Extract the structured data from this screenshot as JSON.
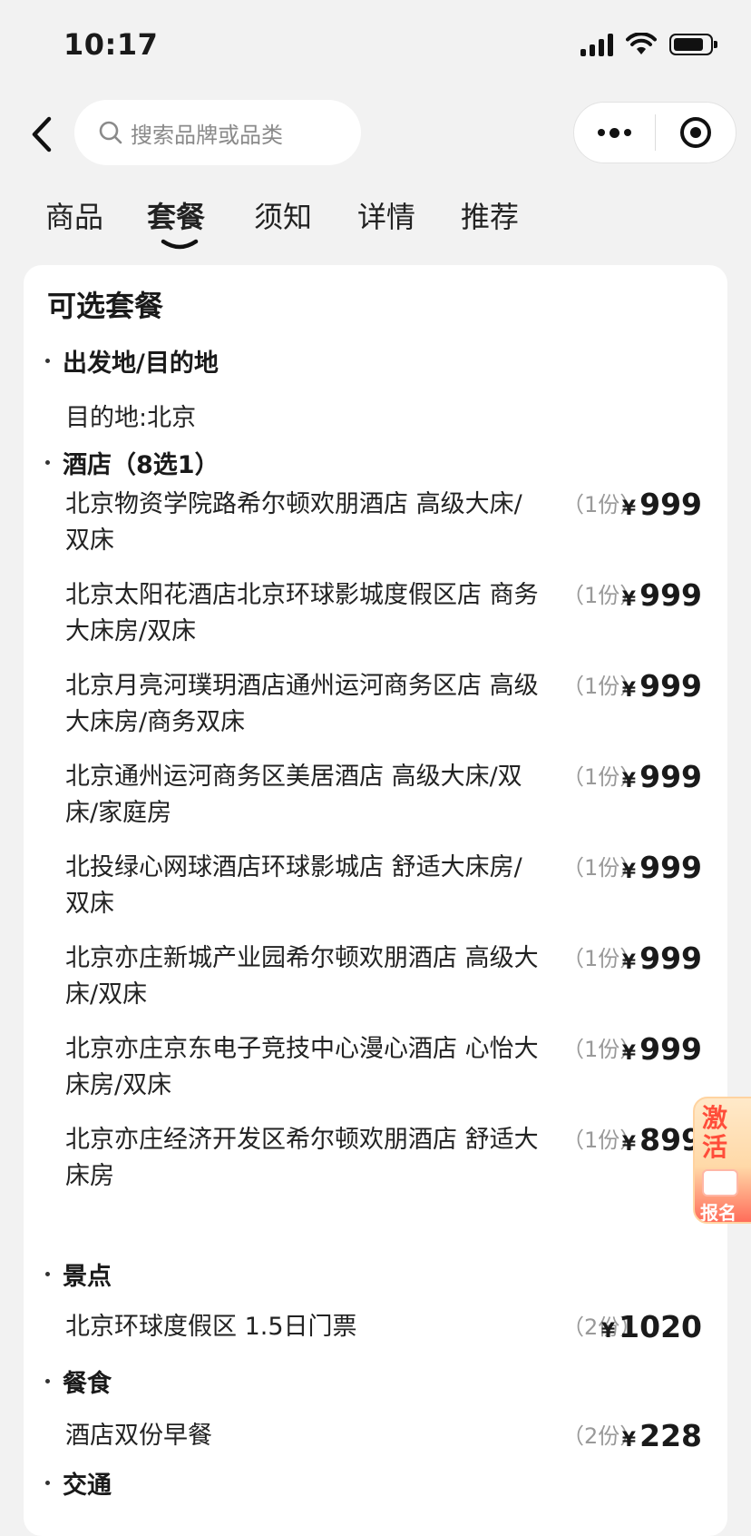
{
  "status_bar": {
    "time": "10:17"
  },
  "search": {
    "placeholder": "搜索品牌或品类"
  },
  "tabs": [
    {
      "label": "商品",
      "active": false
    },
    {
      "label": "套餐",
      "active": true
    },
    {
      "label": "须知",
      "active": false
    },
    {
      "label": "详情",
      "active": false
    },
    {
      "label": "推荐",
      "active": false
    }
  ],
  "card": {
    "title": "可选套餐",
    "origin_section": {
      "title": "出发地/目的地",
      "text": "目的地:北京"
    },
    "hotel_section": {
      "title": "酒店（8选1）",
      "items": [
        {
          "name": "北京物资学院路希尔顿欢朋酒店 高级大床/双床",
          "qty": "（1份）",
          "currency": "¥",
          "price": "999"
        },
        {
          "name": "北京太阳花酒店北京环球影城度假区店 商务大床房/双床",
          "qty": "（1份）",
          "currency": "¥",
          "price": "999"
        },
        {
          "name": "北京月亮河璞玥酒店通州运河商务区店 高级大床房/商务双床",
          "qty": "（1份）",
          "currency": "¥",
          "price": "999"
        },
        {
          "name": "北京通州运河商务区美居酒店 高级大床/双床/家庭房",
          "qty": "（1份）",
          "currency": "¥",
          "price": "999"
        },
        {
          "name": "北投绿心网球酒店环球影城店 舒适大床房/双床",
          "qty": "（1份）",
          "currency": "¥",
          "price": "999"
        },
        {
          "name": "北京亦庄新城产业园希尔顿欢朋酒店 高级大床/双床",
          "qty": "（1份）",
          "currency": "¥",
          "price": "999"
        },
        {
          "name": "北京亦庄京东电子竞技中心漫心酒店 心怡大床房/双床",
          "qty": "（1份）",
          "currency": "¥",
          "price": "999"
        },
        {
          "name": "北京亦庄经济开发区希尔顿欢朋酒店 舒适大床房",
          "qty": "（1份）",
          "currency": "¥",
          "price": "899"
        }
      ]
    },
    "scenic_section": {
      "title": "景点",
      "items": [
        {
          "name": "北京环球度假区 1.5日门票",
          "qty": "（2份）",
          "currency": "¥",
          "price": "1020"
        }
      ]
    },
    "food_section": {
      "title": "餐食",
      "items": [
        {
          "name": "酒店双份早餐",
          "qty": "（2份）",
          "currency": "¥",
          "price": "228"
        }
      ]
    },
    "traffic_section": {
      "title": "交通"
    }
  },
  "float_badge": {
    "text_top": "激活",
    "text_bottom": "报名"
  },
  "colors": {
    "page_bg": "#f2f2f2",
    "card_bg": "#ffffff",
    "qty_gray": "#999999",
    "badge_red": "#ff4d3a"
  }
}
